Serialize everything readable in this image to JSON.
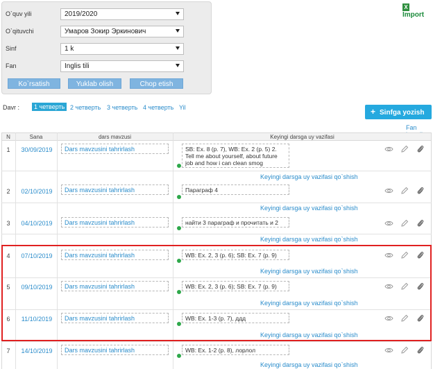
{
  "filters": [
    {
      "label": "O`quv yili",
      "value": "2019/2020"
    },
    {
      "label": "O`qituvchi",
      "value": "Умаров Зокир Эркинович"
    },
    {
      "label": "Sinf",
      "value": "1 k"
    },
    {
      "label": "Fan",
      "value": "Inglis tili"
    }
  ],
  "filter_buttons": [
    "Ko`rsatish",
    "Yuklab olish",
    "Chop etish"
  ],
  "import_label": "Import",
  "davr_label": "Davr :",
  "periods": [
    "1 четверть",
    "2 четверть",
    "3 четверть",
    "4 четверть",
    "Yil"
  ],
  "active_period": "1 четверть",
  "add_button_label": "Sinfga yozish",
  "fan_jurnali_label": "Fan jurnali",
  "table": {
    "headers": [
      "N",
      "Sana",
      "dars mavzusi",
      "Keyingi darsga uy vazifasi"
    ],
    "topic_text": "Dars mavzusini tahrirlash",
    "add_hw_text": "Keyingi darsga uy vazifasi qo`shish",
    "rows": [
      {
        "n": "1",
        "date": "30/09/2019",
        "hw": "SB: Ex. 8 (p. 7), WB: Ex. 2 (p. 5) 2. Tell me about yourself, about future job and how i can clean smog"
      },
      {
        "n": "2",
        "date": "02/10/2019",
        "hw": "Параграф 4"
      },
      {
        "n": "3",
        "date": "04/10/2019",
        "hw": "найти 3 параграф и прочитать и 2"
      },
      {
        "n": "4",
        "date": "07/10/2019",
        "hw": "WB: Ex. 2, 3 (p. 6); SB: Ex. 7 (p. 9)"
      },
      {
        "n": "5",
        "date": "09/10/2019",
        "hw": "WB: Ex. 2, 3 (p. 6); SB: Ex. 7 (p. 9)"
      },
      {
        "n": "6",
        "date": "11/10/2019",
        "hw": "WB: Ex. 1-3 (p. 7), ддд"
      },
      {
        "n": "7",
        "date": "14/10/2019",
        "hw": "WB: Ex. 1-2 (p. 8), лорлол"
      }
    ]
  },
  "colors": {
    "accent": "#25a9df",
    "link": "#2a8ccb",
    "highlight": "#e02020",
    "status_dot": "#2ea84a"
  }
}
